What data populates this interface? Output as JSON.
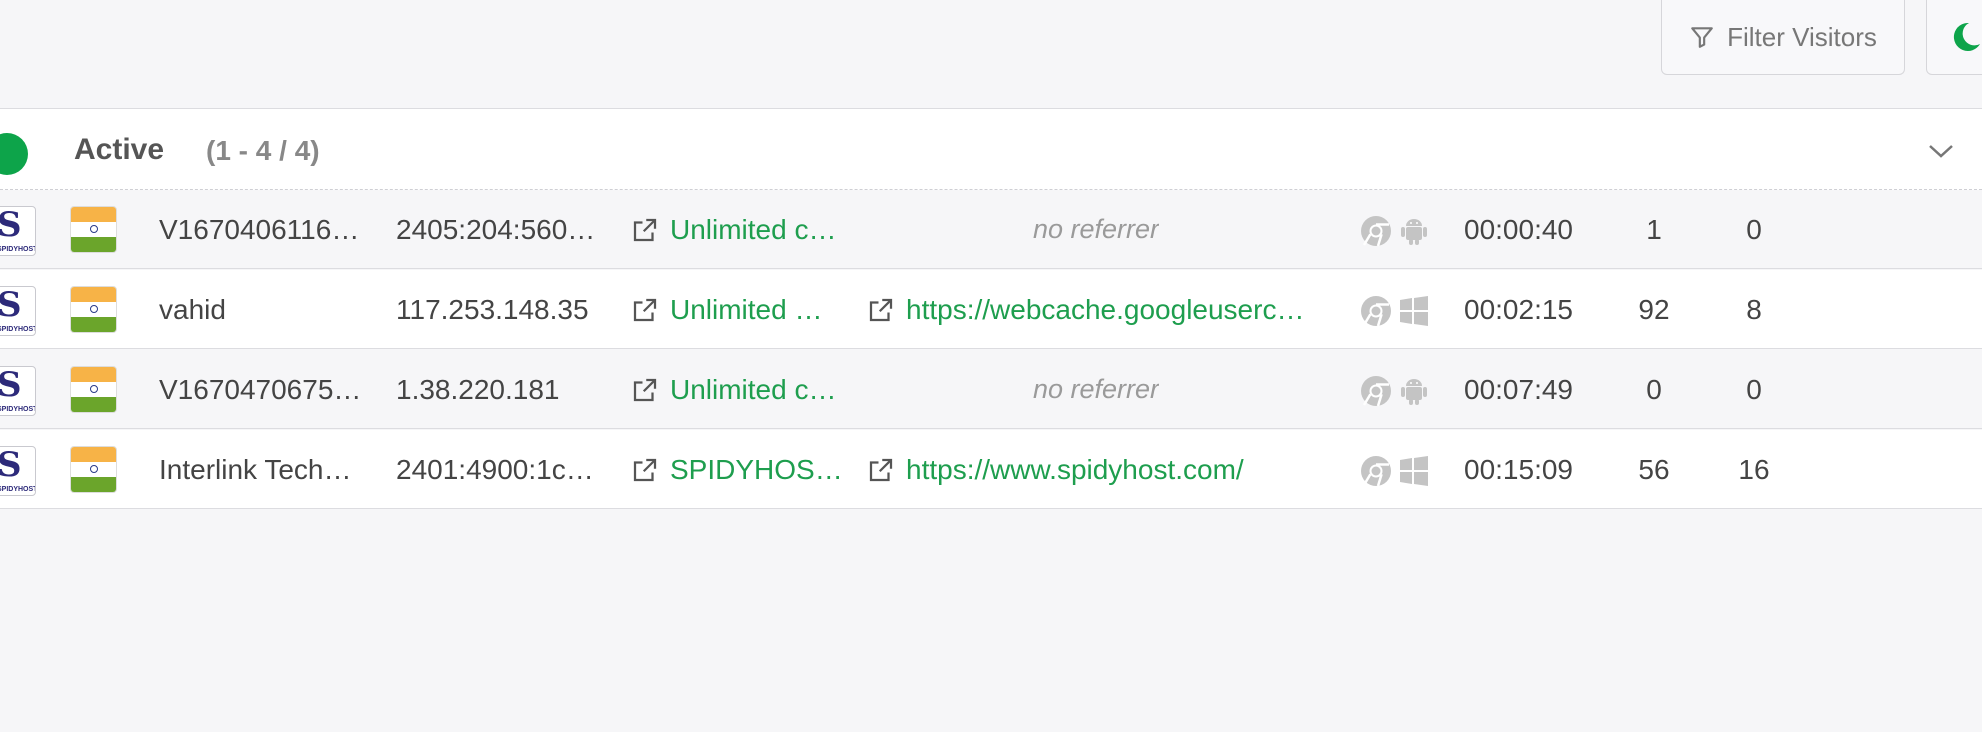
{
  "toolbar": {
    "filter_label": "Filter Visitors",
    "filter_icon": "funnel-icon",
    "theme_icon": "moon-icon"
  },
  "group": {
    "title": "Active",
    "count": "(1 - 4 / 4)",
    "status_color": "#0da44a"
  },
  "accent_color": "#1e9e4e",
  "visitors": [
    {
      "site_logo": "spidyhost-logo",
      "country_flag": "india-flag",
      "name": "V1670406116…",
      "ip": "2405:204:560…",
      "site": "Unlimited c…",
      "referrer": "no referrer",
      "browser_icon": "chrome-icon",
      "os_icon": "android-icon",
      "duration": "00:00:40",
      "count1": "1",
      "count2": "0"
    },
    {
      "site_logo": "spidyhost-logo",
      "country_flag": "india-flag",
      "name": "vahid",
      "ip": "117.253.148.35",
      "site": "Unlimited …",
      "referrer": "https://webcache.googleuserc…",
      "browser_icon": "chrome-icon",
      "os_icon": "windows-icon",
      "duration": "00:02:15",
      "count1": "92",
      "count2": "8"
    },
    {
      "site_logo": "spidyhost-logo",
      "country_flag": "india-flag",
      "name": "V1670470675…",
      "ip": "1.38.220.181",
      "site": "Unlimited c…",
      "referrer": "no referrer",
      "browser_icon": "chrome-icon",
      "os_icon": "android-icon",
      "duration": "00:07:49",
      "count1": "0",
      "count2": "0"
    },
    {
      "site_logo": "spidyhost-logo",
      "country_flag": "india-flag",
      "name": "Interlink Tech…",
      "ip": "2401:4900:1c…",
      "site": "SPIDYHOS…",
      "referrer": "https://www.spidyhost.com/",
      "browser_icon": "chrome-icon",
      "os_icon": "windows-icon",
      "duration": "00:15:09",
      "count1": "56",
      "count2": "16"
    }
  ]
}
